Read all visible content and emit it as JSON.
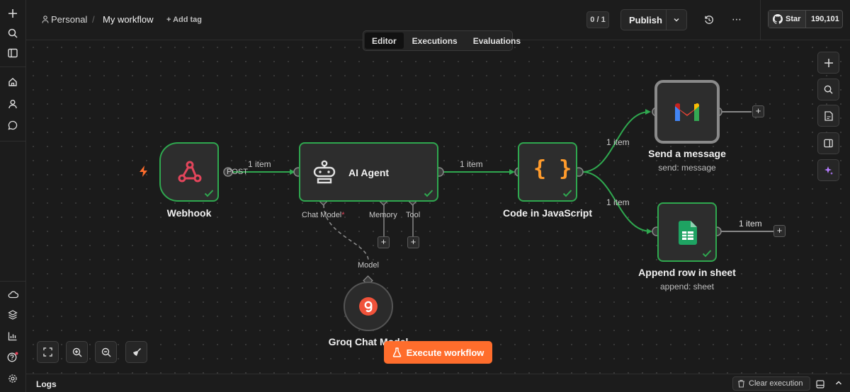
{
  "header": {
    "project": "Personal",
    "workflow_name": "My workflow",
    "add_tag": "+ Add tag",
    "version_counter": "0 / 1",
    "publish_label": "Publish",
    "github_star": "Star",
    "github_count": "190,101"
  },
  "tabs": [
    {
      "label": "Editor",
      "active": true
    },
    {
      "label": "Executions",
      "active": false
    },
    {
      "label": "Evaluations",
      "active": false
    }
  ],
  "nodes": {
    "webhook": {
      "title": "Webhook",
      "output_label": "POST"
    },
    "ai_agent": {
      "title": "AI Agent"
    },
    "code": {
      "title": "Code in JavaScript"
    },
    "gmail": {
      "title": "Send a message",
      "subtitle": "send: message"
    },
    "sheets": {
      "title": "Append row in sheet",
      "subtitle": "append: sheet"
    },
    "groq": {
      "title": "Groq Chat Model"
    }
  },
  "agent_ports": {
    "chat_model": "Chat Model",
    "required_mark": "*",
    "memory": "Memory",
    "tool": "Tool",
    "model": "Model"
  },
  "connection_labels": {
    "webhook_to_agent": "1 item",
    "agent_to_code": "1 item",
    "code_to_gmail": "1 item",
    "code_to_sheets": "1 item",
    "sheets_out": "1 item"
  },
  "execute_button": "Execute workflow",
  "logs": {
    "label": "Logs",
    "clear_execution": "Clear execution"
  },
  "colors": {
    "accent": "#ff6d2c",
    "success": "#2fa84f",
    "background": "#1b1b1b"
  }
}
